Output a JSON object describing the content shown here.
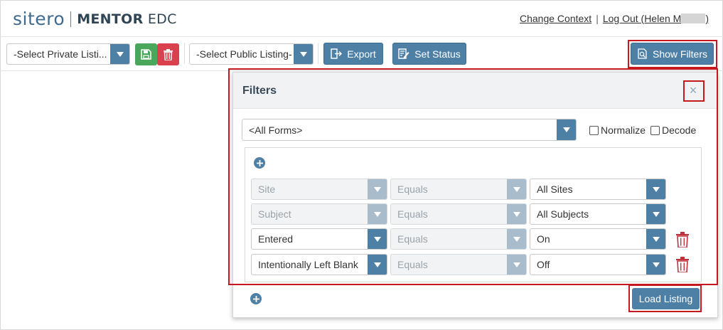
{
  "header": {
    "logo_brand": "sitero",
    "logo_product_bold": "MENTOR",
    "logo_product_light": "EDC",
    "change_context": "Change Context",
    "separator": "|",
    "logout_prefix": "Log Out (Helen M",
    "logout_suffix": ")"
  },
  "toolbar": {
    "private_listing_placeholder": "-Select Private Listi...",
    "public_listing_placeholder": "-Select Public Listing-",
    "export_label": "Export",
    "set_status_label": "Set Status",
    "show_filters_label": "Show Filters"
  },
  "filters": {
    "title": "Filters",
    "close_glyph": "×",
    "forms_select": "<All Forms>",
    "normalize_label": "Normalize",
    "decode_label": "Decode",
    "rows": [
      {
        "field": "Site",
        "operator": "Equals",
        "value": "All Sites",
        "field_disabled": true,
        "deletable": false
      },
      {
        "field": "Subject",
        "operator": "Equals",
        "value": "All Subjects",
        "field_disabled": true,
        "deletable": false
      },
      {
        "field": "Entered",
        "operator": "Equals",
        "value": "On",
        "field_disabled": false,
        "deletable": true
      },
      {
        "field": "Intentionally Left Blank",
        "operator": "Equals",
        "value": "Off",
        "field_disabled": false,
        "deletable": true
      }
    ],
    "load_listing_label": "Load Listing"
  },
  "colors": {
    "accent": "#4e7fa5",
    "save_green": "#4aa65a",
    "delete_red": "#d9414e",
    "highlight_red": "#c41a1f"
  }
}
